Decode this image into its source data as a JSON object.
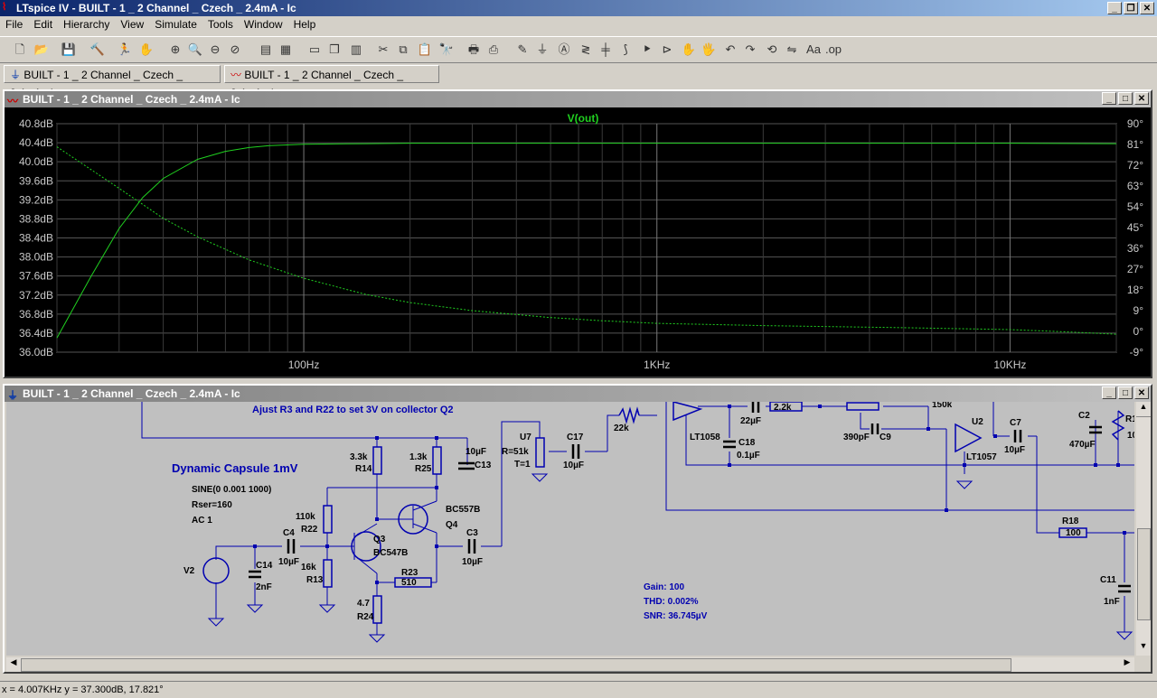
{
  "app": {
    "title": "LTspice IV - BUILT - 1 _ 2 Channel _ Czech _ 2.4mA - Ic",
    "icon": "ltspice-icon"
  },
  "window_buttons": {
    "minimize": "_",
    "restore": "❐",
    "close": "✕"
  },
  "menu": [
    "File",
    "Edit",
    "Hierarchy",
    "View",
    "Simulate",
    "Tools",
    "Window",
    "Help"
  ],
  "tabs": [
    {
      "label": "BUILT - 1 _ 2 Channel _ Czech _ 2.4mA - Ic",
      "icon": "schematic-icon"
    },
    {
      "label": "BUILT - 1 _ 2 Channel _ Czech _ 2.4mA - Ic",
      "icon": "waveform-icon"
    }
  ],
  "plot_window": {
    "title": "BUILT - 1 _ 2 Channel _ Czech _ 2.4mA - Ic",
    "trace_label": "V(out)",
    "colors": {
      "trace": "#20d020",
      "grid": "#555555",
      "axis": "#c0c0c0",
      "background": "#000000"
    }
  },
  "chart_data": {
    "type": "line",
    "title": "V(out)",
    "x_scale": "log",
    "xlim": [
      20,
      20000
    ],
    "x_tick_labels": [
      "100Hz",
      "1KHz",
      "10KHz"
    ],
    "x_ticks": [
      100,
      1000,
      10000
    ],
    "ylim": [
      36.0,
      40.8
    ],
    "y_tick_labels": [
      "40.8dB",
      "40.4dB",
      "40.0dB",
      "39.6dB",
      "39.2dB",
      "38.8dB",
      "38.4dB",
      "38.0dB",
      "37.6dB",
      "37.2dB",
      "36.8dB",
      "36.4dB",
      "36.0dB"
    ],
    "y2lim": [
      -9,
      90
    ],
    "y2_tick_labels": [
      "90°",
      "81°",
      "72°",
      "63°",
      "54°",
      "45°",
      "36°",
      "27°",
      "18°",
      "9°",
      "0°",
      "-9°"
    ],
    "series": [
      {
        "name": "V(out)",
        "style": "solid",
        "x": [
          20,
          25,
          30,
          35,
          40,
          50,
          60,
          70,
          80,
          100,
          150,
          200,
          500,
          1000,
          5000,
          10000,
          20000
        ],
        "y": [
          36.3,
          37.6,
          38.6,
          39.25,
          39.65,
          40.05,
          40.22,
          40.3,
          40.34,
          40.37,
          40.38,
          40.39,
          40.39,
          40.39,
          40.39,
          40.39,
          40.38
        ]
      },
      {
        "name": "V(out) phase",
        "style": "dashed",
        "axis": "y2",
        "x": [
          20,
          30,
          40,
          50,
          70,
          100,
          150,
          200,
          300,
          500,
          700,
          1000,
          2000,
          5000,
          10000,
          15000,
          20000
        ],
        "y": [
          80,
          62,
          49,
          41,
          31,
          23,
          16,
          12.5,
          9,
          6,
          4.6,
          3.5,
          2.5,
          1.6,
          0.8,
          -0.3,
          -1.2
        ]
      }
    ]
  },
  "schematic_window": {
    "title": "BUILT - 1 _ 2 Channel _ Czech _ 2.4mA - Ic",
    "comment": "Ajust R3 and R22 to set 3V on collector Q2",
    "capsule_title": "Dynamic Capsule 1mV",
    "source_params": [
      "SINE(0 0.001 1000)",
      "Rser=160",
      "AC 1"
    ],
    "results": {
      "gain": "Gain: 100",
      "thd": "THD: 0.002%",
      "snr": "SNR: 36.745µV"
    },
    "labels": {
      "r14_val": "3.3k",
      "r14": "R14",
      "r25_val": "1.3k",
      "r25": "R25",
      "c13_val": "10µF",
      "c13": "C13",
      "r22_val": "110k",
      "r22": "R22",
      "r13_val": "16k",
      "r13": "R13",
      "r24_val": "4.7",
      "r24": "R24",
      "r23": "R23",
      "r23_val": "510",
      "q3": "Q3",
      "q3_part": "BC547B",
      "q4": "Q4",
      "q4_part": "BC557B",
      "c4": "C4",
      "c4_val": "10µF",
      "c3": "C3",
      "c3_val": "10µF",
      "c14": "C14",
      "c14_val": "2nF",
      "v2": "V2",
      "u7": "U7",
      "u7_r": "R=51k",
      "u7_t": "T=1",
      "c17": "C17",
      "c17_val": "10µF",
      "r_22k": "22k",
      "u_lt1058": "LT1058",
      "c18": "C18",
      "c18_val": "0.1µF",
      "c_22u": "22µF",
      "r_2_2k": "2.2k",
      "c9_val": "390pF",
      "c9": "C9",
      "r_150k": "150k",
      "u2": "U2",
      "u2_part": "LT1057",
      "c7": "C7",
      "c7_val": "10µF",
      "c2": "C2",
      "c2_val": "470µF",
      "r1": "R1",
      "r1_val": "10",
      "r18": "R18",
      "r18_val": "100",
      "c11": "C11",
      "c11_val": "1nF"
    }
  },
  "status": "x = 4.007KHz    y = 37.300dB, 17.821°"
}
